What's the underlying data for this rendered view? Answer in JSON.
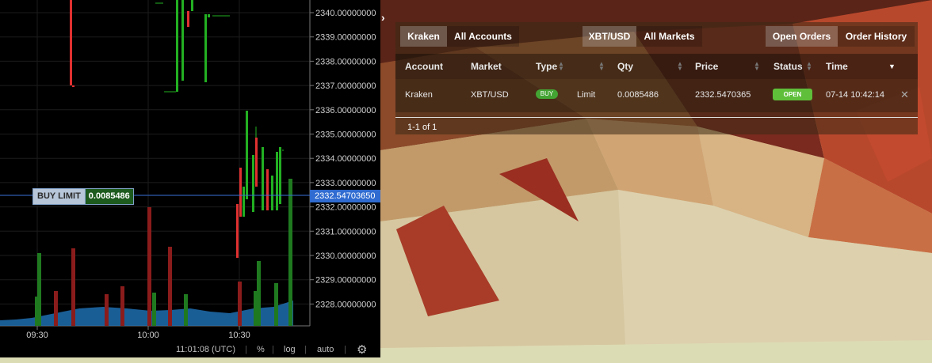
{
  "chart": {
    "price_ticks": [
      "2340.00000000",
      "2339.00000000",
      "2338.00000000",
      "2337.00000000",
      "2336.00000000",
      "2335.00000000",
      "2334.00000000",
      "2333.00000000",
      "2332.00000000",
      "2331.00000000",
      "2330.00000000",
      "2329.00000000",
      "2328.00000000"
    ],
    "time_ticks": [
      "09:30",
      "10:00",
      "10:30"
    ],
    "order_tag": {
      "type": "BUY LIMIT",
      "qty": "0.0085486"
    },
    "price_marker": "2332.54703650",
    "footer": {
      "time": "11:01:08 (UTC)",
      "percent": "%",
      "log": "log",
      "auto": "auto",
      "settings_icon": "gear-icon"
    },
    "colors": {
      "up": "#22b022",
      "down": "#e03030",
      "volume_area": "#1e6fb0",
      "order_line": "#3a6fd8"
    }
  },
  "orders": {
    "account_tabs": [
      "Kraken",
      "All Accounts"
    ],
    "market_tabs": [
      "XBT/USD",
      "All Markets"
    ],
    "view_tabs": [
      "Open Orders",
      "Order History"
    ],
    "columns": [
      "Account",
      "Market",
      "Type",
      "Qty",
      "Price",
      "Status",
      "Time"
    ],
    "rows": [
      {
        "account": "Kraken",
        "market": "XBT/USD",
        "side": "BUY",
        "type": "Limit",
        "qty": "0.0085486",
        "price": "2332.5470365",
        "status": "OPEN",
        "time": "07-14 10:42:14"
      }
    ],
    "pager": "1-1 of 1"
  }
}
